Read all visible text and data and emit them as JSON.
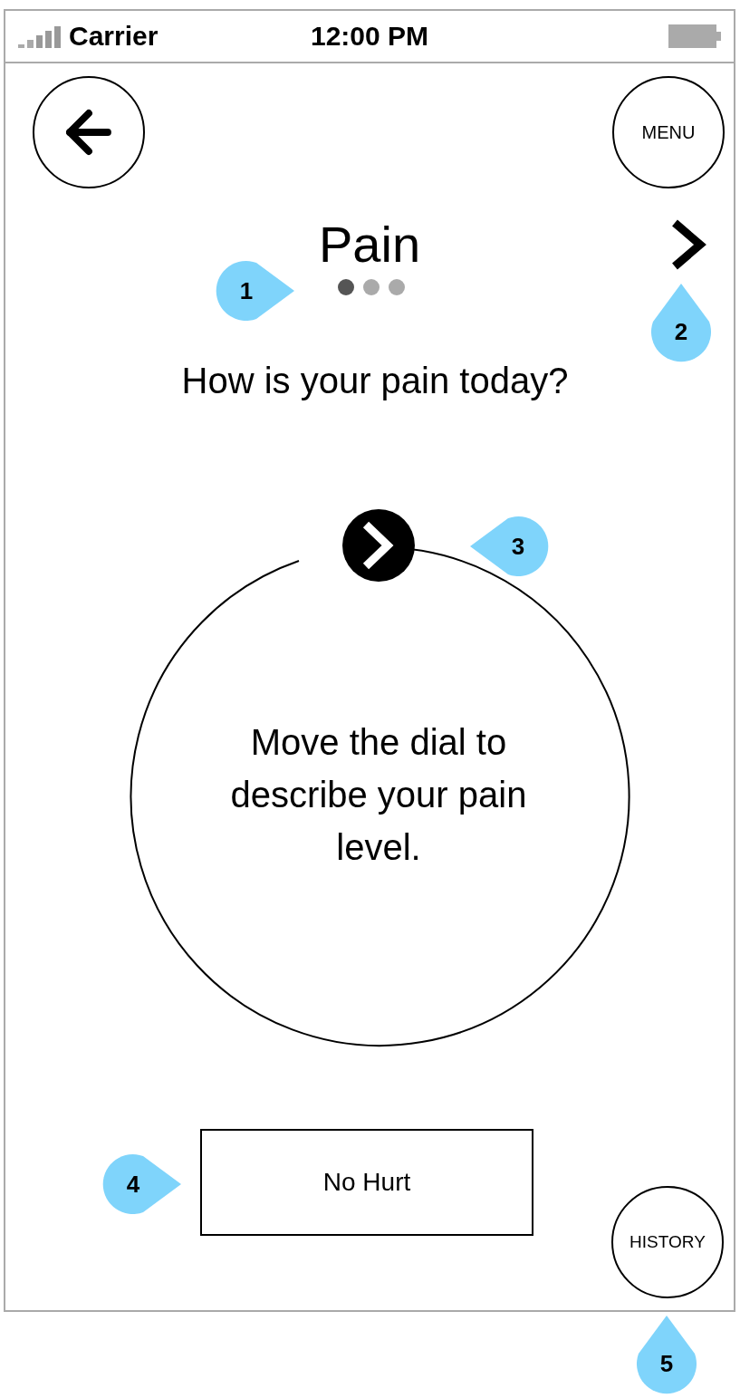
{
  "status_bar": {
    "carrier": "Carrier",
    "time": "12:00 PM"
  },
  "menu_button": "MENU",
  "title": "Pain",
  "page_dots": [
    {
      "selected": true
    },
    {
      "selected": false
    },
    {
      "selected": false
    }
  ],
  "question": "How is your pain today?",
  "dial": {
    "instruction": "Move the dial to describe your pain level."
  },
  "answer_button": "No Hurt",
  "history_button": "HISTORY",
  "callouts": [
    {
      "number": "1"
    },
    {
      "number": "2"
    },
    {
      "number": "3"
    },
    {
      "number": "4"
    },
    {
      "number": "5"
    }
  ]
}
